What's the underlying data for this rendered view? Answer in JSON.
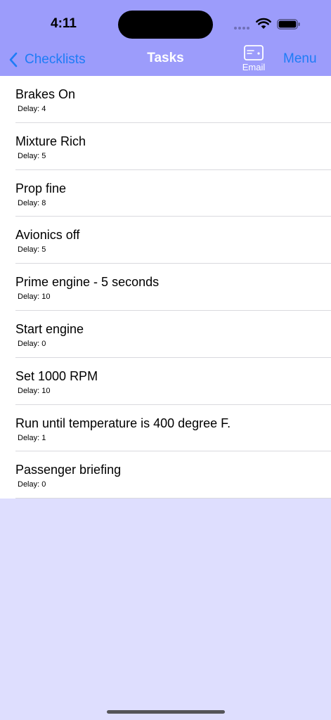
{
  "status_bar": {
    "time": "4:11"
  },
  "nav": {
    "back_label": "Checklists",
    "title": "Tasks",
    "email_label": "Email",
    "menu_label": "Menu"
  },
  "tasks": [
    {
      "title": "Brakes On",
      "delay": "Delay: 4"
    },
    {
      "title": "Mixture Rich",
      "delay": "Delay: 5"
    },
    {
      "title": "Prop fine",
      "delay": "Delay: 8"
    },
    {
      "title": "Avionics off",
      "delay": "Delay: 5"
    },
    {
      "title": "Prime engine - 5 seconds",
      "delay": "Delay: 10"
    },
    {
      "title": "Start engine",
      "delay": "Delay: 0"
    },
    {
      "title": "Set 1000 RPM",
      "delay": "Delay: 10"
    },
    {
      "title": "Run until temperature is 400 degree F.",
      "delay": "Delay: 1"
    },
    {
      "title": "Passenger briefing",
      "delay": "Delay: 0"
    }
  ],
  "colors": {
    "header_bg": "#9c9cfb",
    "page_bg": "#dedefe",
    "accent": "#1e7cf6"
  },
  "icons": {
    "back": "chevron-left-icon",
    "email": "email-card-icon",
    "wifi": "wifi-icon",
    "battery": "battery-icon"
  }
}
